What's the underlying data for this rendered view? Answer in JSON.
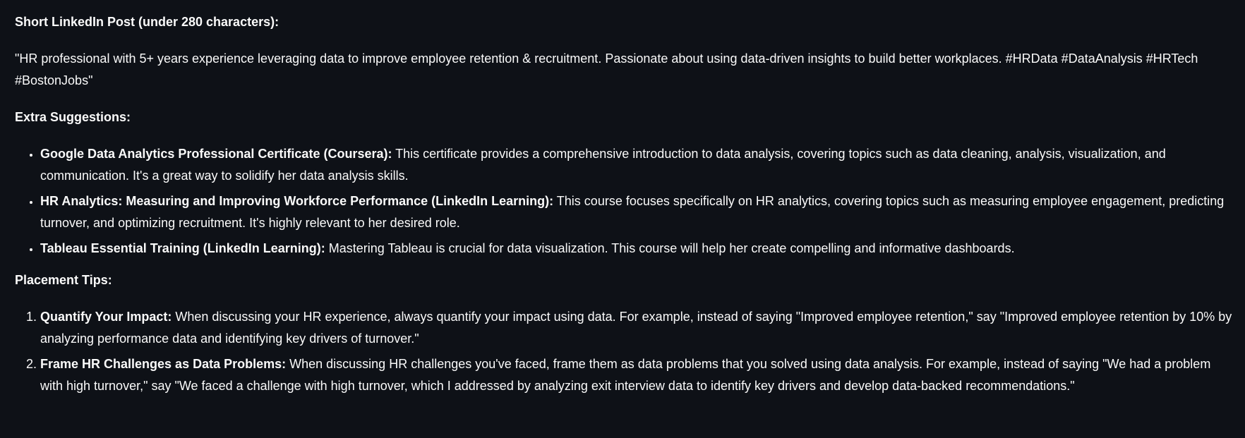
{
  "post": {
    "heading": "Short LinkedIn Post (under 280 characters):",
    "text": "\"HR professional with 5+ years experience leveraging data to improve employee retention & recruitment. Passionate about using data-driven insights to build better workplaces. #HRData #DataAnalysis #HRTech #BostonJobs\""
  },
  "extra": {
    "heading": "Extra Suggestions:",
    "items": [
      {
        "title": "Google Data Analytics Professional Certificate (Coursera):",
        "text": " This certificate provides a comprehensive introduction to data analysis, covering topics such as data cleaning, analysis, visualization, and communication. It's a great way to solidify her data analysis skills."
      },
      {
        "title": "HR Analytics: Measuring and Improving Workforce Performance (LinkedIn Learning):",
        "text": " This course focuses specifically on HR analytics, covering topics such as measuring employee engagement, predicting turnover, and optimizing recruitment. It's highly relevant to her desired role."
      },
      {
        "title": "Tableau Essential Training (LinkedIn Learning):",
        "text": " Mastering Tableau is crucial for data visualization. This course will help her create compelling and informative dashboards."
      }
    ]
  },
  "placement": {
    "heading": "Placement Tips:",
    "items": [
      {
        "title": "Quantify Your Impact:",
        "text": " When discussing your HR experience, always quantify your impact using data. For example, instead of saying \"Improved employee retention,\" say \"Improved employee retention by 10% by analyzing performance data and identifying key drivers of turnover.\""
      },
      {
        "title": "Frame HR Challenges as Data Problems:",
        "text": " When discussing HR challenges you've faced, frame them as data problems that you solved using data analysis. For example, instead of saying \"We had a problem with high turnover,\" say \"We faced a challenge with high turnover, which I addressed by analyzing exit interview data to identify key drivers and develop data-backed recommendations.\""
      }
    ]
  }
}
